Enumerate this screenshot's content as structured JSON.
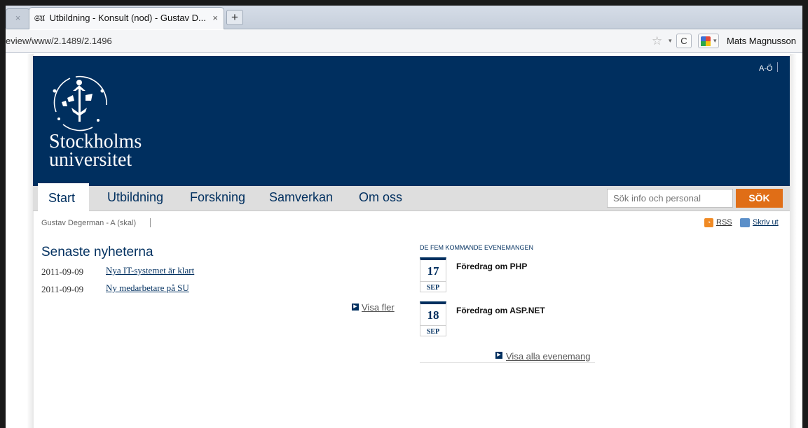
{
  "browser": {
    "inactive_tab_close": "×",
    "active_tab": {
      "favicon": "𝔖𝔘",
      "title": "Utbildning - Konsult (nod) - Gustav D...",
      "close": "×"
    },
    "new_tab": "+",
    "url": "eview/www/2.1489/2.1496",
    "reload": "C",
    "user": "Mats Magnusson",
    "icons": [
      "star-icon",
      "reload-icon",
      "google-icon"
    ]
  },
  "header": {
    "logo_line1": "Stockholms",
    "logo_line2": "universitet",
    "az_label": "A-Ö",
    "colors": {
      "background": "#002f5f",
      "accent": "#e06e17"
    }
  },
  "nav": {
    "items": [
      {
        "label": "Start"
      },
      {
        "label": "Utbildning"
      },
      {
        "label": "Forskning"
      },
      {
        "label": "Samverkan"
      },
      {
        "label": "Om oss"
      }
    ],
    "search_placeholder": "Sök info och personal",
    "search_button": "SÖK"
  },
  "breadcrumb": "Gustav Degerman - A (skal)",
  "tools": {
    "rss": "RSS",
    "print": "Skriv ut"
  },
  "news": {
    "title": "Senaste nyheterna",
    "items": [
      {
        "date": "2011-09-09",
        "title": "Nya IT-systemet är klart"
      },
      {
        "date": "2011-09-09",
        "title": "Ny medarbetare på SU"
      }
    ],
    "more": "Visa fler"
  },
  "events": {
    "title": "DE FEM KOMMANDE EVENEMANGEN",
    "items": [
      {
        "day": "17",
        "month": "SEP",
        "title": "Föredrag om PHP"
      },
      {
        "day": "18",
        "month": "SEP",
        "title": "Föredrag om ASP.NET"
      }
    ],
    "more": "Visa alla evenemang"
  }
}
